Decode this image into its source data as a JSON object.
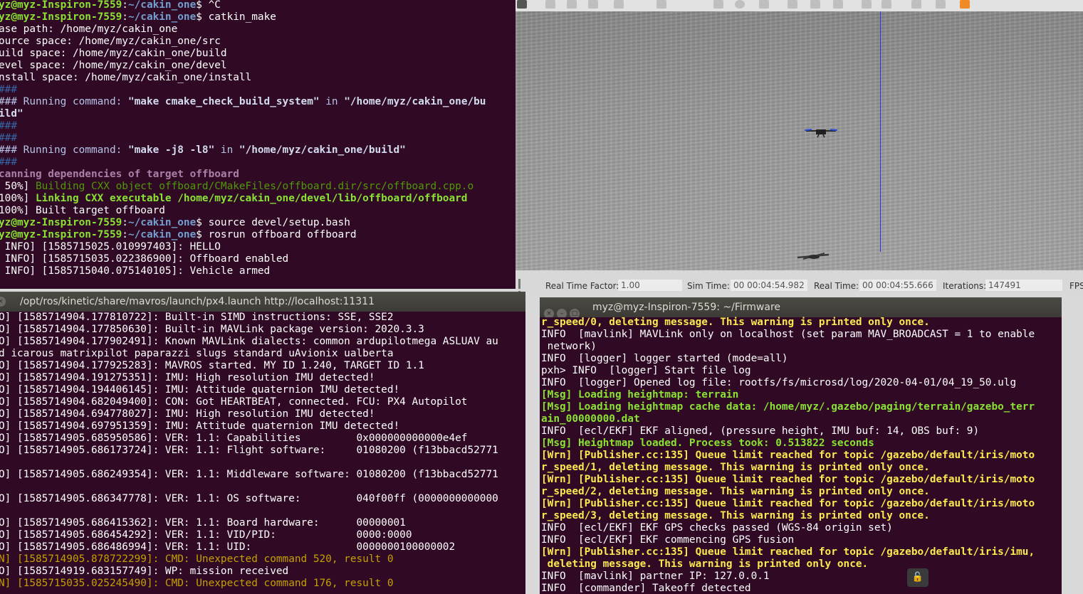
{
  "gazebo": {
    "bottom": {
      "real_time_factor_label": "Real Time Factor:",
      "real_time_factor_value": "1.00",
      "sim_time_label": "Sim Time:",
      "sim_time_value": "00 00:04:54.982",
      "real_time_label": "Real Time:",
      "real_time_value": "00 00:04:55.666",
      "iterations_label": "Iterations:",
      "iterations_value": "147491",
      "fps_label": "FPS"
    }
  },
  "terminal_catkin": {
    "lines": [
      [
        {
          "t": "yz@myz-Inspiron-7559",
          "c": "user"
        },
        {
          "t": ":",
          "c": "plain"
        },
        {
          "t": "~/cakin_one",
          "c": "path"
        },
        {
          "t": "$ ^C",
          "c": "plain"
        }
      ],
      [
        {
          "t": "yz@myz-Inspiron-7559",
          "c": "user"
        },
        {
          "t": ":",
          "c": "plain"
        },
        {
          "t": "~/cakin_one",
          "c": "path"
        },
        {
          "t": "$ catkin_make",
          "c": "plain"
        }
      ],
      [
        {
          "t": "ase path: /home/myz/cakin_one",
          "c": "plain"
        }
      ],
      [
        {
          "t": "ource space: /home/myz/cakin_one/src",
          "c": "plain"
        }
      ],
      [
        {
          "t": "uild space: /home/myz/cakin_one/build",
          "c": "plain"
        }
      ],
      [
        {
          "t": "evel space: /home/myz/cakin_one/devel",
          "c": "plain"
        }
      ],
      [
        {
          "t": "nstall space: /home/myz/cakin_one/install",
          "c": "plain"
        }
      ],
      [
        {
          "t": "###",
          "c": "hash"
        }
      ],
      [
        {
          "t": "### Running command: ",
          "c": "cmd"
        },
        {
          "t": "\"make cmake_check_build_system\"",
          "c": "cmdq"
        },
        {
          "t": " in ",
          "c": "cmd"
        },
        {
          "t": "\"/home/myz/cakin_one/bu",
          "c": "cmdq"
        }
      ],
      [
        {
          "t": "ild\"",
          "c": "cmdq"
        }
      ],
      [
        {
          "t": "###",
          "c": "hash"
        }
      ],
      [
        {
          "t": "###",
          "c": "hash"
        }
      ],
      [
        {
          "t": "### Running command: ",
          "c": "cmd"
        },
        {
          "t": "\"make -j8 -l8\"",
          "c": "cmdq"
        },
        {
          "t": " in ",
          "c": "cmd"
        },
        {
          "t": "\"/home/myz/cakin_one/build\"",
          "c": "cmdq"
        }
      ],
      [
        {
          "t": "###",
          "c": "hash"
        }
      ],
      [
        {
          "t": "canning dependencies of target offboard",
          "c": "scan"
        }
      ],
      [
        {
          "t": " 50%] ",
          "c": "plain"
        },
        {
          "t": "Building CXX object offboard/CMakeFiles/offboard.dir/src/offboard.cpp.o",
          "c": "build"
        }
      ],
      [
        {
          "t": "100%] ",
          "c": "plain"
        },
        {
          "t": "Linking CXX executable /home/myz/cakin_one/devel/lib/offboard/offboard",
          "c": "link"
        }
      ],
      [
        {
          "t": "100%] Built target offboard",
          "c": "plain"
        }
      ],
      [
        {
          "t": "yz@myz-Inspiron-7559",
          "c": "user"
        },
        {
          "t": ":",
          "c": "plain"
        },
        {
          "t": "~/cakin_one",
          "c": "path"
        },
        {
          "t": "$ source devel/setup.bash",
          "c": "plain"
        }
      ],
      [
        {
          "t": "yz@myz-Inspiron-7559",
          "c": "user"
        },
        {
          "t": ":",
          "c": "plain"
        },
        {
          "t": "~/cakin_one",
          "c": "path"
        },
        {
          "t": "$ rosrun offboard offboard",
          "c": "plain"
        }
      ],
      [
        {
          "t": " INFO] [1585715025.010997403]: HELLO",
          "c": "plain"
        }
      ],
      [
        {
          "t": " INFO] [1585715035.022386900]: Offboard enabled",
          "c": "plain"
        }
      ],
      [
        {
          "t": " INFO] [1585715040.075140105]: Vehicle armed",
          "c": "plain"
        }
      ]
    ]
  },
  "terminal_mavros": {
    "title": "/opt/ros/kinetic/share/mavros/launch/px4.launch http://localhost:11311",
    "lines": [
      [
        {
          "t": "O] [1585714904.177810722]: Built-in SIMD instructions: SSE, SSE2",
          "c": "plain"
        }
      ],
      [
        {
          "t": "O] [1585714904.177850630]: Built-in MAVLink package version: 2020.3.3",
          "c": "plain"
        }
      ],
      [
        {
          "t": "O] [1585714904.177902491]: Known MAVLink dialects: common ardupilotmega ASLUAV au",
          "c": "plain"
        }
      ],
      [
        {
          "t": "d icarous matrixpilot paparazzi slugs standard uAvionix ualberta",
          "c": "plain"
        }
      ],
      [
        {
          "t": "O] [1585714904.177925283]: MAVROS started. MY ID 1.240, TARGET ID 1.1",
          "c": "plain"
        }
      ],
      [
        {
          "t": "O] [1585714904.191275351]: IMU: High resolution IMU detected!",
          "c": "plain"
        }
      ],
      [
        {
          "t": "O] [1585714904.194406145]: IMU: Attitude quaternion IMU detected!",
          "c": "plain"
        }
      ],
      [
        {
          "t": "O] [1585714904.682049400]: CON: Got HEARTBEAT, connected. FCU: PX4 Autopilot",
          "c": "plain"
        }
      ],
      [
        {
          "t": "O] [1585714904.694778027]: IMU: High resolution IMU detected!",
          "c": "plain"
        }
      ],
      [
        {
          "t": "O] [1585714904.697951359]: IMU: Attitude quaternion IMU detected!",
          "c": "plain"
        }
      ],
      [
        {
          "t": "O] [1585714905.685950586]: VER: 1.1: Capabilities         0x000000000000e4ef",
          "c": "plain"
        }
      ],
      [
        {
          "t": "O] [1585714905.686173724]: VER: 1.1: Flight software:     01080200 (f13bbacd52771",
          "c": "plain"
        }
      ],
      [
        {
          "t": "",
          "c": "plain"
        }
      ],
      [
        {
          "t": "O] [1585714905.686249354]: VER: 1.1: Middleware software: 01080200 (f13bbacd52771",
          "c": "plain"
        }
      ],
      [
        {
          "t": "",
          "c": "plain"
        }
      ],
      [
        {
          "t": "O] [1585714905.686347778]: VER: 1.1: OS software:         040f00ff (0000000000000",
          "c": "plain"
        }
      ],
      [
        {
          "t": "",
          "c": "plain"
        }
      ],
      [
        {
          "t": "O] [1585714905.686415362]: VER: 1.1: Board hardware:      00000001",
          "c": "plain"
        }
      ],
      [
        {
          "t": "O] [1585714905.686454292]: VER: 1.1: VID/PID:             0000:0000",
          "c": "plain"
        }
      ],
      [
        {
          "t": "O] [1585714905.686486994]: VER: 1.1: UID:                 0000000100000002",
          "c": "plain"
        }
      ],
      [
        {
          "t": "N] [1585714905.878722299]: CMD: Unexpected command 520, result 0",
          "c": "mav-warn"
        }
      ],
      [
        {
          "t": "O] [1585714919.683157749]: WP: mission received",
          "c": "plain"
        }
      ],
      [
        {
          "t": "N] [1585715035.025245490]: CMD: Unexpected command 176, result 0",
          "c": "mav-warn"
        }
      ]
    ]
  },
  "terminal_firmware": {
    "title": "myz@myz-Inspiron-7559: ~/Firmware",
    "lines": [
      [
        {
          "t": "r_speed/0, deleting message. This warning is printed only once.",
          "c": "warn"
        }
      ],
      [
        {
          "t": "INFO  [mavlink] MAVLink only on localhost (set param MAV_BROADCAST = 1 to enable",
          "c": "plain"
        }
      ],
      [
        {
          "t": " network)",
          "c": "plain"
        }
      ],
      [
        {
          "t": "INFO  [logger] logger started (mode=all)",
          "c": "plain"
        }
      ],
      [
        {
          "t": "pxh> INFO  [logger] Start file log",
          "c": "plain"
        }
      ],
      [
        {
          "t": "INFO  [logger] Opened log file: rootfs/fs/microsd/log/2020-04-01/04_19_50.ulg",
          "c": "plain"
        }
      ],
      [
        {
          "t": "[Msg] Loading heightmap: terrain",
          "c": "msg"
        }
      ],
      [
        {
          "t": "[Msg] Loading heightmap cache data: /home/myz/.gazebo/paging/terrain/gazebo_terr",
          "c": "msg"
        }
      ],
      [
        {
          "t": "ain_00000000.dat",
          "c": "msg"
        }
      ],
      [
        {
          "t": "INFO  [ecl/EKF] EKF aligned, (pressure height, IMU buf: 14, OBS buf: 9)",
          "c": "plain"
        }
      ],
      [
        {
          "t": "[Msg] Heightmap loaded. Process took: 0.513822 seconds",
          "c": "msg"
        }
      ],
      [
        {
          "t": "[Wrn] [Publisher.cc:135] Queue limit reached for topic /gazebo/default/iris/moto",
          "c": "warn"
        }
      ],
      [
        {
          "t": "r_speed/1, deleting message. This warning is printed only once.",
          "c": "warn"
        }
      ],
      [
        {
          "t": "[Wrn] [Publisher.cc:135] Queue limit reached for topic /gazebo/default/iris/moto",
          "c": "warn"
        }
      ],
      [
        {
          "t": "r_speed/2, deleting message. This warning is printed only once.",
          "c": "warn"
        }
      ],
      [
        {
          "t": "[Wrn] [Publisher.cc:135] Queue limit reached for topic /gazebo/default/iris/moto",
          "c": "warn"
        }
      ],
      [
        {
          "t": "r_speed/3, deleting message. This warning is printed only once.",
          "c": "warn"
        }
      ],
      [
        {
          "t": "INFO  [ecl/EKF] EKF GPS checks passed (WGS-84 origin set)",
          "c": "plain"
        }
      ],
      [
        {
          "t": "INFO  [ecl/EKF] EKF commencing GPS fusion",
          "c": "plain"
        }
      ],
      [
        {
          "t": "[Wrn] [Publisher.cc:135] Queue limit reached for topic /gazebo/default/iris/imu,",
          "c": "warn"
        }
      ],
      [
        {
          "t": " deleting message. This warning is printed only once.",
          "c": "warn"
        }
      ],
      [
        {
          "t": "INFO  [mavlink] partner IP: 127.0.0.1",
          "c": "plain"
        }
      ],
      [
        {
          "t": "INFO  [commander] Takeoff detected",
          "c": "plain"
        }
      ]
    ]
  }
}
